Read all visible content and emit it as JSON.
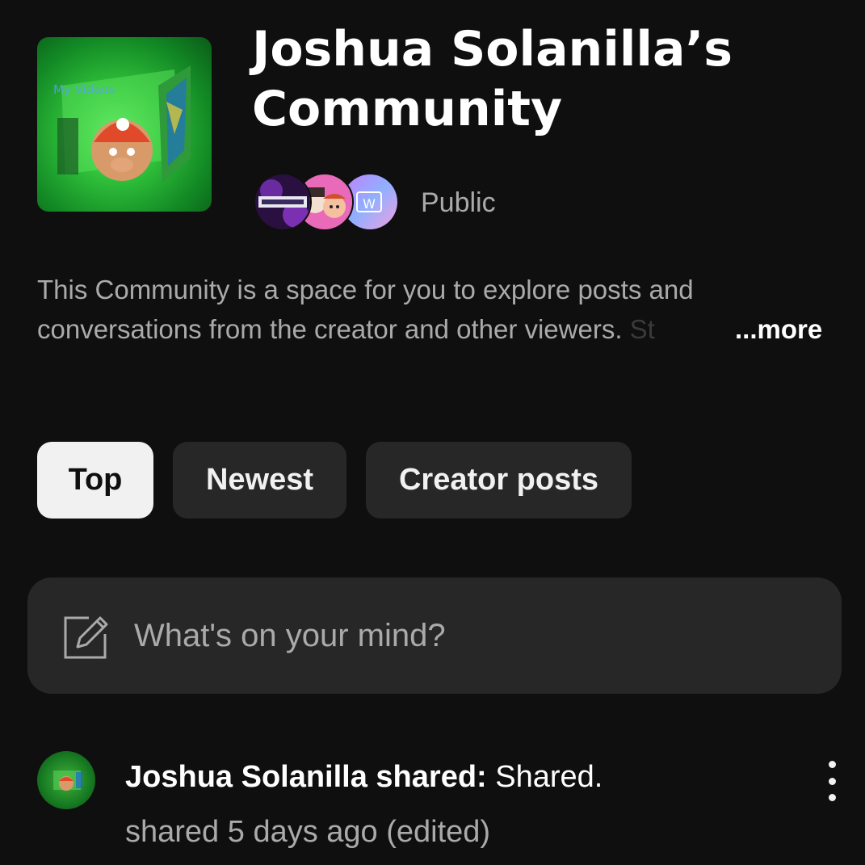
{
  "community": {
    "title": "Joshua Solanilla’s Community",
    "visibility": "Public",
    "thumbnail_text": "My Videos",
    "member_avatar_3_text": "W",
    "description_line1": "This Community is a space for you to explore posts and",
    "description_line2": "conversations from the creator and other viewers. ",
    "description_fade": "St",
    "more_label": "...more"
  },
  "chips": [
    {
      "label": "Top",
      "active": true
    },
    {
      "label": "Newest",
      "active": false
    },
    {
      "label": "Creator posts",
      "active": false
    }
  ],
  "composer": {
    "placeholder": "What's on your mind?",
    "icon": "edit-icon"
  },
  "post": {
    "author": "Joshua Solanilla shared:",
    "text": " Shared.",
    "meta": "shared 5 days ago (edited)",
    "menu_icon": "more-vert-icon"
  },
  "colors": {
    "background": "#0f0f0f",
    "chip_active": "#f1f1f1",
    "chip_inactive": "#272727",
    "secondary_text": "#aaaaaa"
  }
}
